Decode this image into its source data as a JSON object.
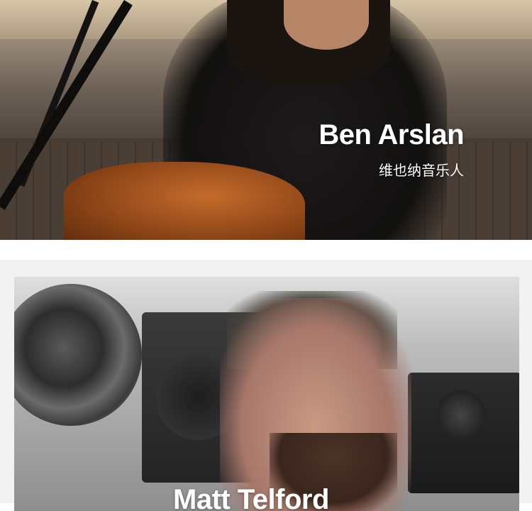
{
  "hero": {
    "name": "Ben Arslan",
    "subtitle": "维也纳音乐人"
  },
  "card": {
    "name": "Matt Telford"
  }
}
